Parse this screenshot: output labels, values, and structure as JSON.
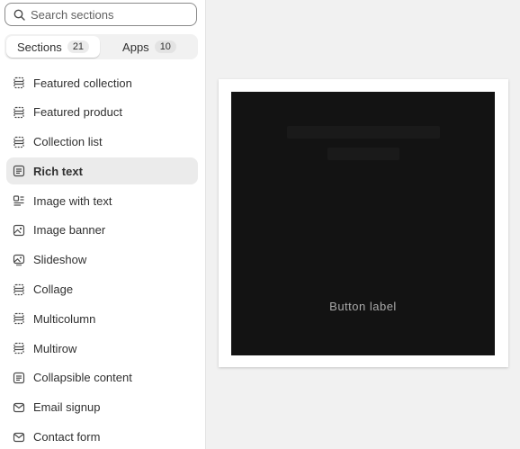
{
  "search": {
    "placeholder": "Search sections"
  },
  "tabs": [
    {
      "label": "Sections",
      "count": "21",
      "active": true
    },
    {
      "label": "Apps",
      "count": "10",
      "active": false
    }
  ],
  "sections": [
    {
      "label": "Featured collection",
      "icon": "grid-icon"
    },
    {
      "label": "Featured product",
      "icon": "grid-icon"
    },
    {
      "label": "Collection list",
      "icon": "grid-icon"
    },
    {
      "label": "Rich text",
      "icon": "text-block-icon",
      "selected": true
    },
    {
      "label": "Image with text",
      "icon": "image-text-icon"
    },
    {
      "label": "Image banner",
      "icon": "image-icon"
    },
    {
      "label": "Slideshow",
      "icon": "slideshow-icon"
    },
    {
      "label": "Collage",
      "icon": "grid-icon"
    },
    {
      "label": "Multicolumn",
      "icon": "grid-icon"
    },
    {
      "label": "Multirow",
      "icon": "grid-icon"
    },
    {
      "label": "Collapsible content",
      "icon": "text-block-icon"
    },
    {
      "label": "Email signup",
      "icon": "envelope-icon"
    },
    {
      "label": "Contact form",
      "icon": "envelope-icon"
    }
  ],
  "preview": {
    "button_label": "Button label"
  }
}
